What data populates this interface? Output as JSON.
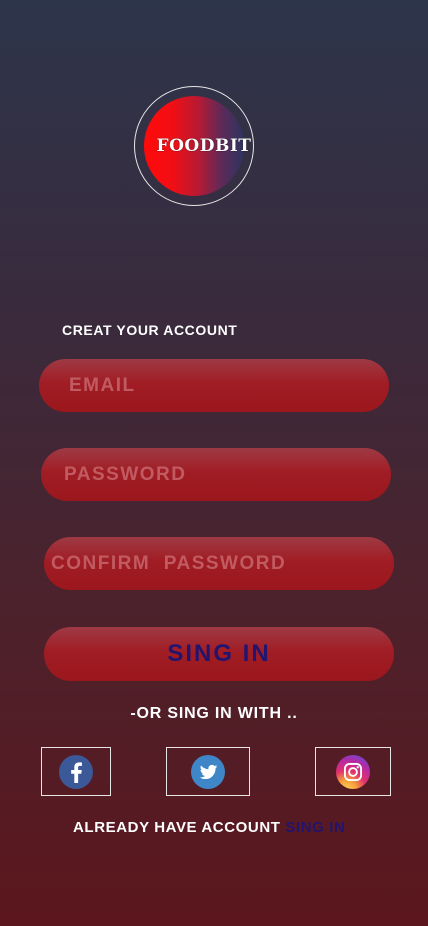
{
  "logo": {
    "text": "FOODBIT"
  },
  "form": {
    "title": "CREAT YOUR ACCOUNT",
    "email_placeholder": "EMAIL",
    "email_value": "",
    "password_placeholder": "PASSWORD",
    "password_value": "",
    "confirm_placeholder": "CONFIRM  PASSWORD",
    "confirm_value": "",
    "submit_label": "SING IN"
  },
  "social": {
    "divider_text": "-OR SING IN WITH ..",
    "providers": [
      {
        "name": "facebook",
        "icon": "facebook-icon"
      },
      {
        "name": "twitter",
        "icon": "twitter-icon"
      },
      {
        "name": "instagram",
        "icon": "instagram-icon"
      }
    ]
  },
  "footer": {
    "already_text": "ALREADY HAVE ACCOUNT",
    "signin_link": "SING IN"
  },
  "colors": {
    "accent": "#23146e",
    "field": "#a11d25",
    "facebook": "#3b5998",
    "twitter": "#3f86c8"
  }
}
